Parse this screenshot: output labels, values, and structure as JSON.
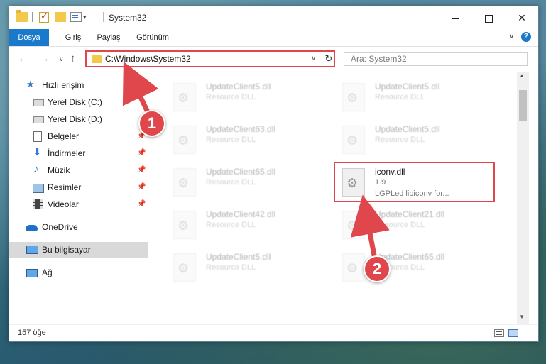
{
  "window": {
    "title": "System32"
  },
  "ribbon": {
    "tabs": [
      "Dosya",
      "Giriş",
      "Paylaş",
      "Görünüm"
    ]
  },
  "navbar": {
    "address": "C:\\Windows\\System32",
    "search_placeholder": "Ara: System32"
  },
  "sidebar": {
    "items": [
      {
        "label": "Hızlı erişim",
        "icon": "star-icon"
      },
      {
        "label": "Yerel Disk (C:)",
        "icon": "drive-icon"
      },
      {
        "label": "Yerel Disk (D:)",
        "icon": "drive-icon"
      },
      {
        "label": "Belgeler",
        "icon": "documents-icon"
      },
      {
        "label": "İndirmeler",
        "icon": "download-icon"
      },
      {
        "label": "Müzik",
        "icon": "music-icon"
      },
      {
        "label": "Resimler",
        "icon": "pictures-icon"
      },
      {
        "label": "Videolar",
        "icon": "videos-icon"
      },
      {
        "label": "OneDrive",
        "icon": "cloud-icon"
      },
      {
        "label": "Bu bilgisayar",
        "icon": "computer-icon"
      },
      {
        "label": "Ağ",
        "icon": "network-icon"
      }
    ]
  },
  "files": [
    {
      "name": "UpdateClient5.dll",
      "desc": "Resource DLL"
    },
    {
      "name": "UpdateClient5.dll",
      "desc": "Resource DLL"
    },
    {
      "name": "UpdateClient63.dll",
      "desc": "Resource DLL"
    },
    {
      "name": "UpdateClient5.dll",
      "desc": "Resource DLL"
    },
    {
      "name": "UpdateClient65.dll",
      "desc": "Resource DLL"
    },
    {
      "name": "iconv.dll",
      "desc": "1.9",
      "extra": "LGPLed libiconv for..."
    },
    {
      "name": "UpdateClient42.dll",
      "desc": "Resource DLL"
    },
    {
      "name": "UpdateClient21.dll",
      "desc": "Resource DLL"
    },
    {
      "name": "UpdateClient5.dll",
      "desc": "Resource DLL"
    },
    {
      "name": "UpdateClient65.dll",
      "desc": "Resource DLL"
    }
  ],
  "status": {
    "count": "157 öğe"
  },
  "annotations": {
    "step1": "1",
    "step2": "2"
  },
  "colors": {
    "accent": "#1979ca",
    "highlight": "#e0474c"
  }
}
